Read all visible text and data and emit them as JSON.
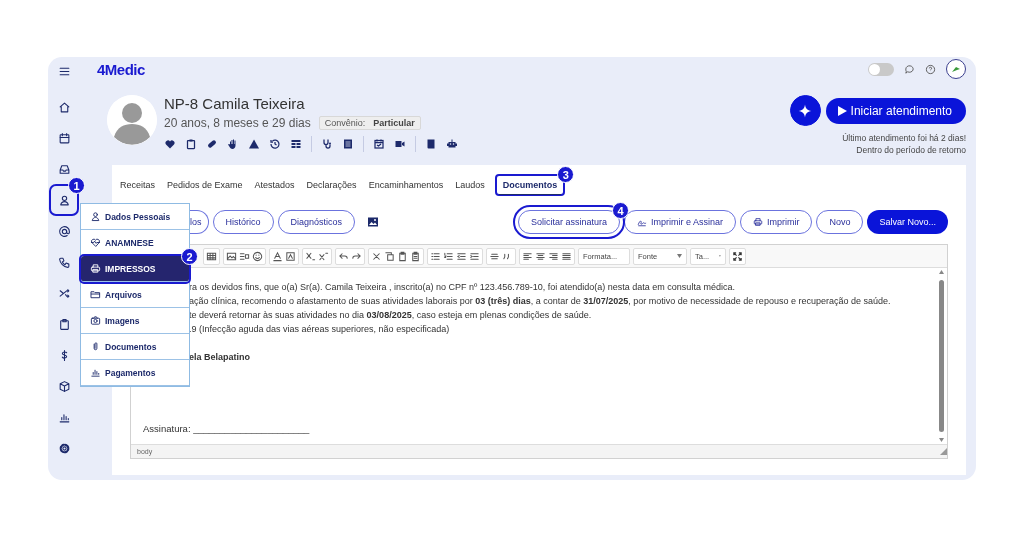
{
  "topbar": {
    "logo": "4Medic",
    "theme_toggle": {
      "on": false
    }
  },
  "sidebar": {
    "items": [
      {
        "kind": "menu"
      },
      {
        "kind": "home"
      },
      {
        "kind": "calendar"
      },
      {
        "kind": "inbox"
      },
      {
        "kind": "person",
        "callout": "1"
      },
      {
        "kind": "at"
      },
      {
        "kind": "phone"
      },
      {
        "kind": "shuffle"
      },
      {
        "kind": "clipboard"
      },
      {
        "kind": "dollar"
      },
      {
        "kind": "cube"
      },
      {
        "kind": "chart"
      },
      {
        "kind": "gear"
      }
    ]
  },
  "patient": {
    "name": "NP-8 Camila Teixeira",
    "age": "20 anos, 8 meses e 29 dias",
    "insurance_label": "Convênio:",
    "insurance": "Particular"
  },
  "start": {
    "label": "Iniciar atendimento",
    "notes": [
      "Último atendimento foi há 2 dias!",
      "Dentro do período de retorno"
    ]
  },
  "tabs": [
    {
      "label": "Receitas",
      "selected": false
    },
    {
      "label": "Pedidos de Exame",
      "selected": false
    },
    {
      "label": "Atestados",
      "selected": false
    },
    {
      "label": "Declarações",
      "selected": false
    },
    {
      "label": "Encaminhamentos",
      "selected": false
    },
    {
      "label": "Laudos",
      "selected": false
    },
    {
      "label": "Documentos",
      "selected": true,
      "callout": "3"
    }
  ],
  "left_buttons": [
    "los",
    "Histórico",
    "Diagnósticos"
  ],
  "actions": [
    {
      "label": "Solicitar assinatura",
      "kind": "outline",
      "callout": "4"
    },
    {
      "label": "Imprimir e Assinar",
      "kind": "sign"
    },
    {
      "label": "Imprimir",
      "kind": "print"
    },
    {
      "label": "Novo",
      "kind": "outline"
    },
    {
      "label": "Salvar Novo...",
      "kind": "primary"
    }
  ],
  "editor": {
    "dropdowns": [
      "Formata...",
      "Fonte",
      "Ta..."
    ],
    "lines": [
      {
        "text": "ra os devidos fins, que o(a) Sr(a). Camila Teixeira , inscrito(a) no CPF nº 123.456.789-10, foi atendido(a) nesta data em consulta médica.",
        "bold": false
      },
      {
        "text": "ação clínica, recomendo o afastamento de suas atividades laborais por **03 (três) dias**, a contar de **31/07/2025**, por motivo de necessidade de repouso e recuperação de saúde.",
        "bold": false
      },
      {
        "text": "te deverá retornar às suas atividades no dia **03/08/2025**, caso esteja em plenas condições de saúde.",
        "bold": false
      },
      {
        "text": ".9 (Infecção aguda das vias aéreas superiores, não especificada)",
        "bold": false
      },
      {
        "text": "ela Belapatino",
        "bold": true
      }
    ],
    "signature": "Assinatura: ______________________",
    "path": "body"
  },
  "menu": {
    "items": [
      {
        "label": "Dados Pessoais",
        "kind": "person",
        "selected": false
      },
      {
        "label": "ANAMNESE",
        "kind": "heartbeat",
        "selected": false
      },
      {
        "label": "IMPRESSOS",
        "kind": "print",
        "selected": true,
        "callout": "2"
      },
      {
        "label": "Arquivos",
        "kind": "folder",
        "selected": false
      },
      {
        "label": "Imagens",
        "kind": "camera",
        "selected": false
      },
      {
        "label": "Documentos",
        "kind": "paperclip",
        "selected": false
      },
      {
        "label": "Pagamentos",
        "kind": "chart",
        "selected": false
      }
    ]
  }
}
